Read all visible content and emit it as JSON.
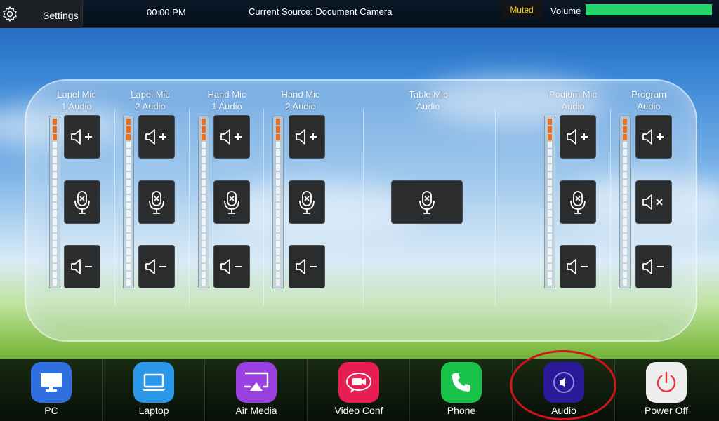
{
  "topbar": {
    "settings_label": "Settings",
    "clock": "00:00 PM",
    "source": "Current Source: Document Camera",
    "muted": "Muted",
    "volume_label": "Volume",
    "volume_level": 1.0
  },
  "channels": [
    {
      "label": "Lapel Mic\n1 Audio",
      "has_meter": true,
      "controls": [
        "volume-up",
        "mic-mute",
        "volume-down"
      ]
    },
    {
      "label": "Lapel Mic\n2 Audio",
      "has_meter": true,
      "controls": [
        "volume-up",
        "mic-mute",
        "volume-down"
      ]
    },
    {
      "label": "Hand Mic\n1 Audio",
      "has_meter": true,
      "controls": [
        "volume-up",
        "mic-mute",
        "volume-down"
      ]
    },
    {
      "label": "Hand Mic\n2 Audio",
      "has_meter": true,
      "controls": [
        "volume-up",
        "mic-mute",
        "volume-down"
      ]
    },
    {
      "label": "Table Mic\nAudio",
      "has_meter": false,
      "controls": [
        "mic-mute"
      ]
    },
    {
      "label": "Podium Mic\nAudio",
      "has_meter": true,
      "controls": [
        "volume-up",
        "mic-mute",
        "volume-down"
      ]
    },
    {
      "label": "Program\nAudio",
      "has_meter": true,
      "controls": [
        "volume-up",
        "speaker-mute",
        "volume-down"
      ]
    }
  ],
  "dock": [
    {
      "label": "PC",
      "icon": "monitor-icon",
      "color": "#2f6fe0"
    },
    {
      "label": "Laptop",
      "icon": "laptop-icon",
      "color": "#2a97e8"
    },
    {
      "label": "Air Media",
      "icon": "airplay-icon",
      "color": "#9a3fe0"
    },
    {
      "label": "Video Conf",
      "icon": "video-camera-icon",
      "color": "#e81d52"
    },
    {
      "label": "Phone",
      "icon": "phone-icon",
      "color": "#19c24a"
    },
    {
      "label": "Audio",
      "icon": "speaker-icon",
      "color": "#2a1a9a"
    },
    {
      "label": "Power Off",
      "icon": "power-icon",
      "color": "#eeeeee"
    }
  ],
  "colors": {
    "accent_volume": "#22d66b",
    "muted_text": "#ffd21a",
    "highlight": "#d0141a",
    "meter_active": "#f06d1a"
  }
}
